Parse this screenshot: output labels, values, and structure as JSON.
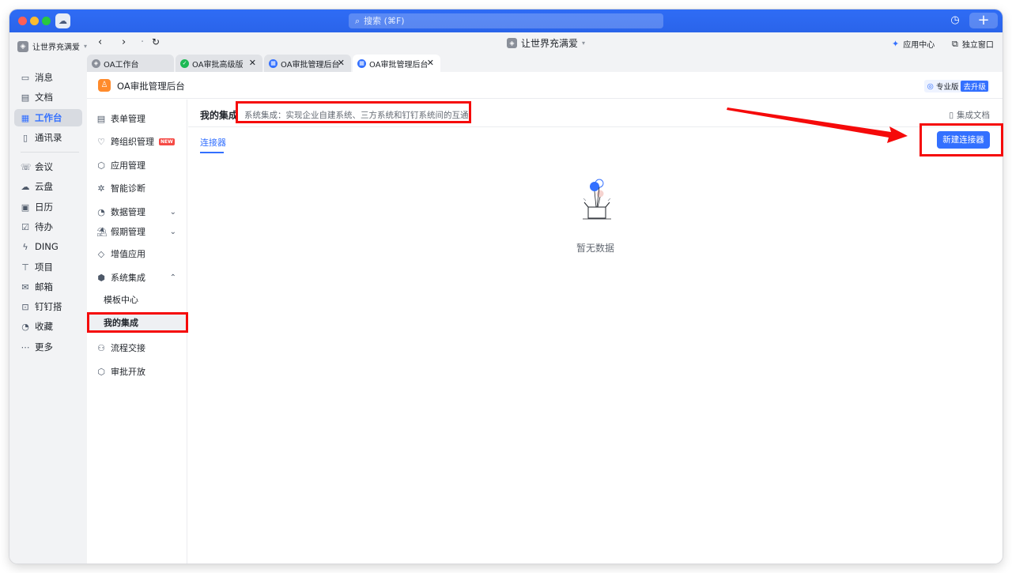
{
  "topbar": {
    "search_placeholder": "搜索 (⌘F)",
    "plus_label": "+"
  },
  "org": {
    "name": "让世界充满爱"
  },
  "leftnav": [
    {
      "label": "消息",
      "icon": "message-icon"
    },
    {
      "label": "文档",
      "icon": "doc-icon"
    },
    {
      "label": "工作台",
      "icon": "workbench-icon",
      "active": true
    },
    {
      "label": "通讯录",
      "icon": "contacts-icon"
    },
    {
      "label": "会议",
      "icon": "meeting-icon"
    },
    {
      "label": "云盘",
      "icon": "cloud-icon"
    },
    {
      "label": "日历",
      "icon": "calendar-icon"
    },
    {
      "label": "待办",
      "icon": "todo-icon"
    },
    {
      "label": "DING",
      "icon": "ding-icon"
    },
    {
      "label": "项目",
      "icon": "project-icon"
    },
    {
      "label": "邮箱",
      "icon": "mail-icon"
    },
    {
      "label": "钉钉搭",
      "icon": "build-icon"
    },
    {
      "label": "收藏",
      "icon": "favorite-icon"
    },
    {
      "label": "更多",
      "icon": "more-icon"
    }
  ],
  "browser": {
    "doc_title": "让世界充满爱",
    "app_center": "应用中心",
    "detach_window": "独立窗口"
  },
  "tabs": [
    {
      "label": "OA工作台"
    },
    {
      "label": "OA审批高级版"
    },
    {
      "label": "OA审批管理后台"
    },
    {
      "label": "OA审批管理后台",
      "active": true
    }
  ],
  "page": {
    "app_title": "OA审批管理后台",
    "edition": "专业版",
    "upgrade": "去升级"
  },
  "subnav": {
    "items": [
      {
        "label": "表单管理"
      },
      {
        "label": "跨组织管理",
        "badge": "NEW"
      },
      {
        "label": "应用管理"
      },
      {
        "label": "智能诊断"
      },
      {
        "label": "数据管理"
      },
      {
        "label": "假期管理"
      },
      {
        "label": "增值应用"
      },
      {
        "label": "系统集成"
      },
      {
        "label": "模板中心"
      },
      {
        "label": "我的集成",
        "active": true
      },
      {
        "label": "流程交接"
      },
      {
        "label": "审批开放"
      }
    ]
  },
  "main": {
    "title": "我的集成",
    "description": "系统集成：实现企业自建系统、三方系统和钉钉系统间的互通",
    "doc_link": "集成文档",
    "tab_connector": "连接器",
    "new_connector_button": "新建连接器",
    "empty_text": "暂无数据"
  },
  "colors": {
    "accent": "#3370ff",
    "annotation": "#f50a0a",
    "topbar": "#2f6cf5"
  }
}
